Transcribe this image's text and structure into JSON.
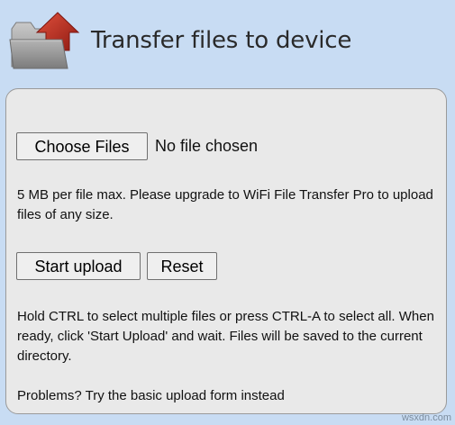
{
  "header": {
    "title": "Transfer files to device",
    "icon": "upload-folder-icon"
  },
  "upload_form": {
    "choose_files_label": "Choose Files",
    "file_status": "No file chosen",
    "limit_text": "5 MB per file max. Please upgrade to WiFi File Transfer Pro to upload files of any size.",
    "start_upload_label": "Start upload",
    "reset_label": "Reset",
    "help_text": "Hold CTRL to select multiple files or press CTRL-A to select all. When ready, click 'Start Upload' and wait. Files will be saved to the current directory.",
    "problems_prefix": "Problems? ",
    "problems_link": "Try the basic upload form instead"
  },
  "watermark": "wsxdn.com",
  "colors": {
    "background": "#c8dcf3",
    "panel": "#e9e9e9",
    "folder": "#9b9b9b",
    "arrow": "#b8281c"
  }
}
